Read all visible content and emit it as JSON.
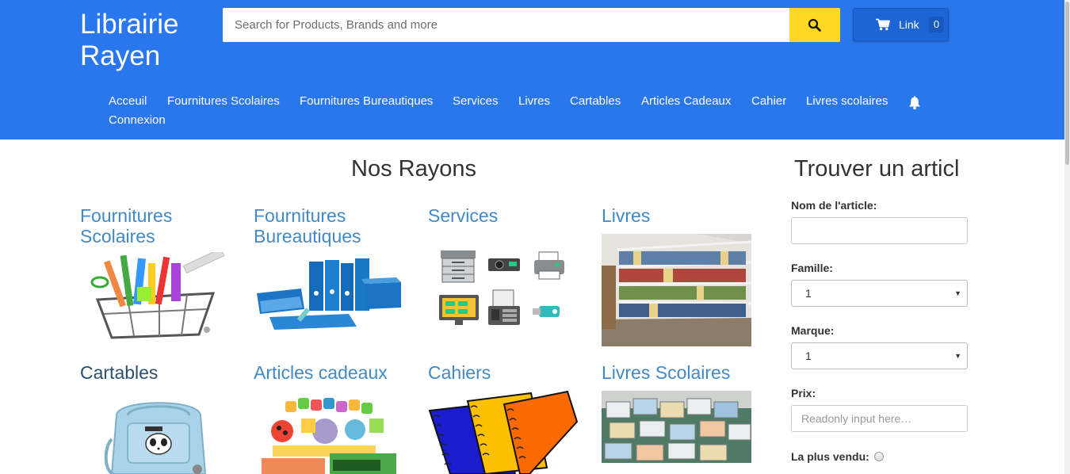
{
  "header": {
    "brand_line1": "Librairie",
    "brand_line2": "Rayen",
    "search_placeholder": "Search for Products, Brands and more",
    "search_icon": "search-icon",
    "cart_icon": "cart-icon",
    "cart_label": "Link",
    "cart_count": "0",
    "bell_icon": "bell-icon",
    "color_primary": "#2a76ed",
    "color_search_button": "#fcd823"
  },
  "nav": {
    "items": [
      "Acceuil",
      "Fournitures Scolaires",
      "Fournitures Bureautiques",
      "Services",
      "Livres",
      "Cartables",
      "Articles Cadeaux",
      "Cahier",
      "Livres scolaires",
      "Connexion"
    ]
  },
  "main": {
    "title": "Nos Rayons",
    "rayons": [
      {
        "line1": "Fournitures",
        "line2": "Scolaires"
      },
      {
        "line1": "Fournitures",
        "line2": "Bureautiques"
      },
      {
        "line1": "Services",
        "line2": ""
      },
      {
        "line1": "Livres",
        "line2": ""
      },
      {
        "line1": "Cartables",
        "line2": ""
      },
      {
        "line1": "Articles cadeaux",
        "line2": ""
      },
      {
        "line1": "Cahiers",
        "line2": ""
      },
      {
        "line1": "Livres Scolaires",
        "line2": ""
      }
    ]
  },
  "sidebar": {
    "title": "Trouver un articl",
    "name_label": "Nom de l'article:",
    "name_value": "",
    "famille_label": "Famille:",
    "famille_value": "1",
    "marque_label": "Marque:",
    "marque_value": "1",
    "prix_label": "Prix:",
    "prix_placeholder": "Readonly input here…",
    "best_label": "La plus vendu:"
  }
}
